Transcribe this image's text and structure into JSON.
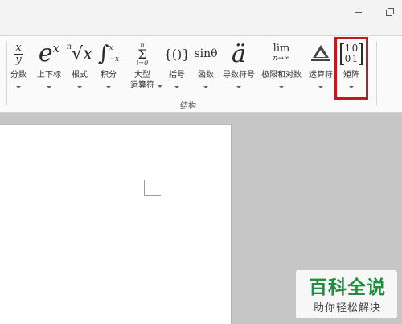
{
  "window": {
    "minimize_icon": "minimize-icon",
    "restore_icon": "restore-icon"
  },
  "ribbon": {
    "group_label": "结构",
    "highlight_color": "#c8161d",
    "buttons": [
      {
        "label": "分数",
        "icon": "fraction-icon",
        "glyph_num": "x",
        "glyph_den": "y"
      },
      {
        "label": "上下标",
        "icon": "script-icon",
        "glyph": "e",
        "glyph_sup": "x"
      },
      {
        "label": "根式",
        "icon": "radical-icon",
        "glyph_index": "n",
        "glyph": "√x"
      },
      {
        "label": "积分",
        "icon": "integral-icon",
        "glyph": "∫",
        "glyph_sup": "x",
        "glyph_sub": "−x"
      },
      {
        "label": "大型",
        "label2": "运算符",
        "icon": "large-operator-icon",
        "glyph_top": "n",
        "glyph": "Σ",
        "glyph_bottom": "i=0"
      },
      {
        "label": "括号",
        "icon": "bracket-icon",
        "glyph": "{()}"
      },
      {
        "label": "函数",
        "icon": "function-icon",
        "glyph": "sinθ"
      },
      {
        "label": "导数符号",
        "icon": "accent-icon",
        "glyph": "ä"
      },
      {
        "label": "极限和对数",
        "icon": "limit-icon",
        "glyph": "lim",
        "glyph_sub": "n→∞"
      },
      {
        "label": "运算符",
        "icon": "operator-icon"
      },
      {
        "label": "矩阵",
        "icon": "matrix-icon",
        "cells": [
          "1",
          "0",
          "0",
          "1"
        ]
      }
    ]
  },
  "watermark": {
    "title": "百科全说",
    "subtitle": "助你轻松解决"
  }
}
